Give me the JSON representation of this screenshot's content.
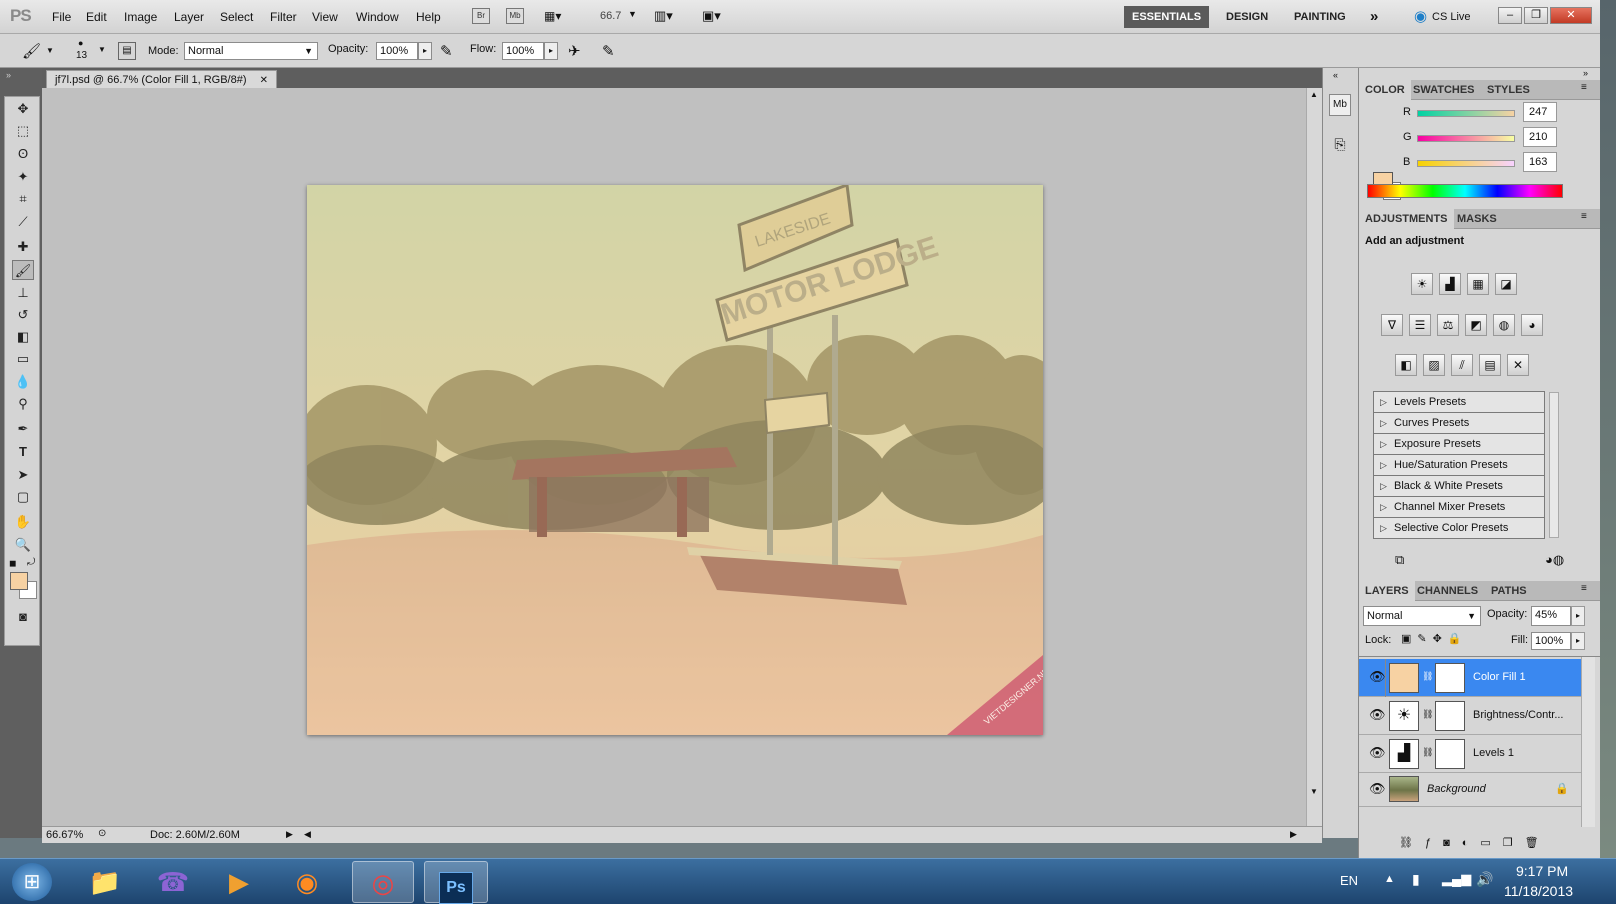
{
  "app": {
    "logo": "PS"
  },
  "menu": [
    "File",
    "Edit",
    "Image",
    "Layer",
    "Select",
    "Filter",
    "View",
    "Window",
    "Help"
  ],
  "appbar": {
    "bridge": "Br",
    "minibridge": "Mb",
    "zoom": "66.7"
  },
  "workspaces": [
    "ESSENTIALS",
    "DESIGN",
    "PAINTING"
  ],
  "more_workspaces": "»",
  "cslive": "CS Live",
  "window_buttons": {
    "minimize": "–",
    "restore": "❐",
    "close": "✕"
  },
  "options": {
    "brush_size": "13",
    "mode_label": "Mode:",
    "mode_value": "Normal",
    "opacity_label": "Opacity:",
    "opacity_value": "100%",
    "flow_label": "Flow:",
    "flow_value": "100%"
  },
  "document": {
    "tab_title": "jf7l.psd @ 66.7% (Color Fill 1, RGB/8#)",
    "close": "✕"
  },
  "status": {
    "zoom": "66.67%",
    "doc": "Doc: 2.60M/2.60M"
  },
  "photo": {
    "sign_top": "LAKESIDE",
    "sign_main": "MOTOR LODGE",
    "watermark": "VIETDESIGNER.NET"
  },
  "color_panel": {
    "tabs": [
      "COLOR",
      "SWATCHES",
      "STYLES"
    ],
    "channels": [
      {
        "label": "R",
        "value": "247"
      },
      {
        "label": "G",
        "value": "210"
      },
      {
        "label": "B",
        "value": "163"
      }
    ],
    "foreground": "#f7d2a3"
  },
  "adjustments_panel": {
    "tabs": [
      "ADJUSTMENTS",
      "MASKS"
    ],
    "heading": "Add an adjustment",
    "presets": [
      "Levels Presets",
      "Curves Presets",
      "Exposure Presets",
      "Hue/Saturation Presets",
      "Black & White Presets",
      "Channel Mixer Presets",
      "Selective Color Presets"
    ]
  },
  "layers_panel": {
    "tabs": [
      "LAYERS",
      "CHANNELS",
      "PATHS"
    ],
    "blend_mode": "Normal",
    "opacity_label": "Opacity:",
    "opacity_value": "45%",
    "lock_label": "Lock:",
    "fill_label": "Fill:",
    "fill_value": "100%",
    "layers": [
      {
        "name": "Color Fill 1",
        "selected": true
      },
      {
        "name": "Brightness/Contr..."
      },
      {
        "name": "Levels 1"
      },
      {
        "name": "Background"
      }
    ]
  },
  "taskbar": {
    "lang": "EN",
    "time": "9:17 PM",
    "date": "11/18/2013"
  }
}
